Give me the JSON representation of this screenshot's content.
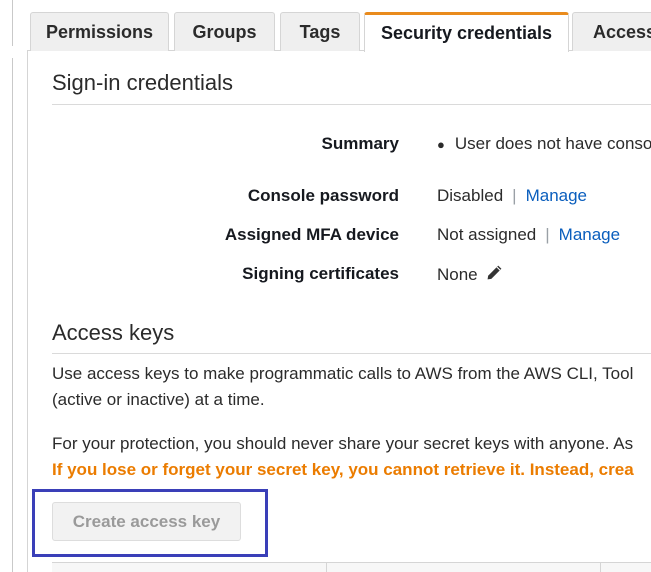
{
  "tabs": [
    {
      "label": "Permissions",
      "active": false
    },
    {
      "label": "Groups",
      "active": false
    },
    {
      "label": "Tags",
      "active": false
    },
    {
      "label": "Security credentials",
      "active": true
    },
    {
      "label": "Access",
      "active": false
    }
  ],
  "signin": {
    "title": "Sign-in credentials",
    "rows": [
      {
        "label": "Summary",
        "value": "User does not have conso"
      },
      {
        "label": "Console password",
        "value": "Disabled",
        "link": "Manage"
      },
      {
        "label": "Assigned MFA device",
        "value": "Not assigned",
        "link": "Manage"
      },
      {
        "label": "Signing certificates",
        "value": "None",
        "icon": "pencil-icon"
      }
    ]
  },
  "access_keys": {
    "title": "Access keys",
    "desc_line1": "Use access keys to make programmatic calls to AWS from the AWS CLI, Tool",
    "desc_line2": "(active or inactive) at a time.",
    "protection": "For your protection, you should never share your secret keys with anyone. As",
    "warning": "If you lose or forget your secret key, you cannot retrieve it. Instead, crea",
    "create_button": "Create access key",
    "create_button_enabled": false
  },
  "colors": {
    "accent_tab": "#e98b1d",
    "link": "#0a5ebd",
    "warning": "#eb7c00",
    "highlight_box": "#3a3fb8"
  }
}
